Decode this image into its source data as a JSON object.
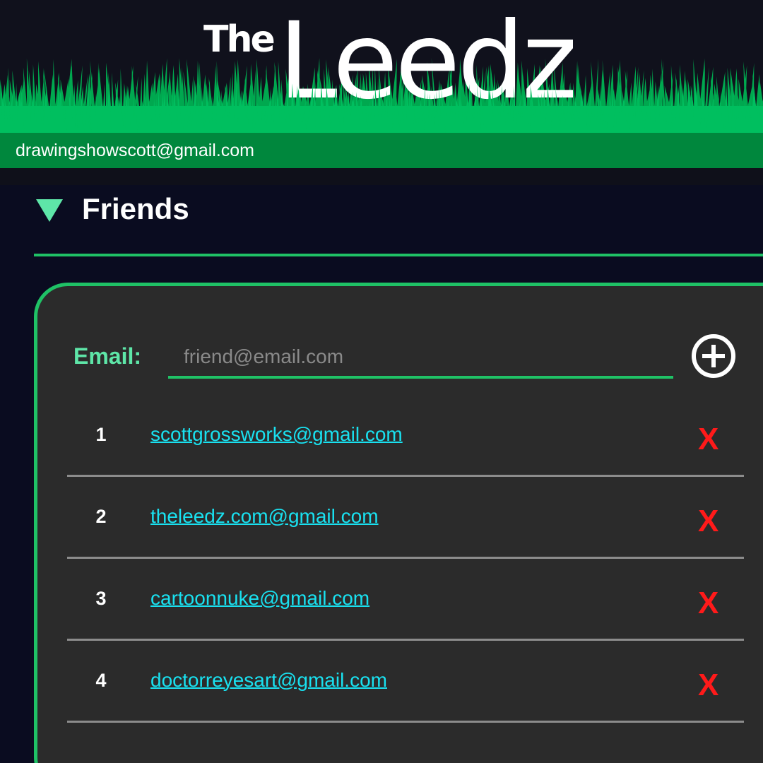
{
  "header": {
    "logo_the": "The",
    "logo_leedz": "Leedz",
    "user_email": "drawingshowscott@gmail.com"
  },
  "friends": {
    "title": "Friends",
    "email_label": "Email:",
    "email_placeholder": "friend@email.com",
    "email_value": "",
    "add_icon": "plus-circle-icon",
    "delete_label": "X",
    "items": [
      {
        "num": "1",
        "email": "scottgrossworks@gmail.com"
      },
      {
        "num": "2",
        "email": "theleedz.com@gmail.com"
      },
      {
        "num": "3",
        "email": "cartoonnuke@gmail.com"
      },
      {
        "num": "4",
        "email": "doctorreyesart@gmail.com"
      }
    ]
  },
  "colors": {
    "brand_green": "#00c060",
    "bar_green": "#00873d",
    "accent_mint": "#5ee6a8",
    "link_cyan": "#19e1f0",
    "delete_red": "#ff1a1a",
    "panel_bg": "#2b2b2b",
    "page_bg": "#0a0c20"
  }
}
